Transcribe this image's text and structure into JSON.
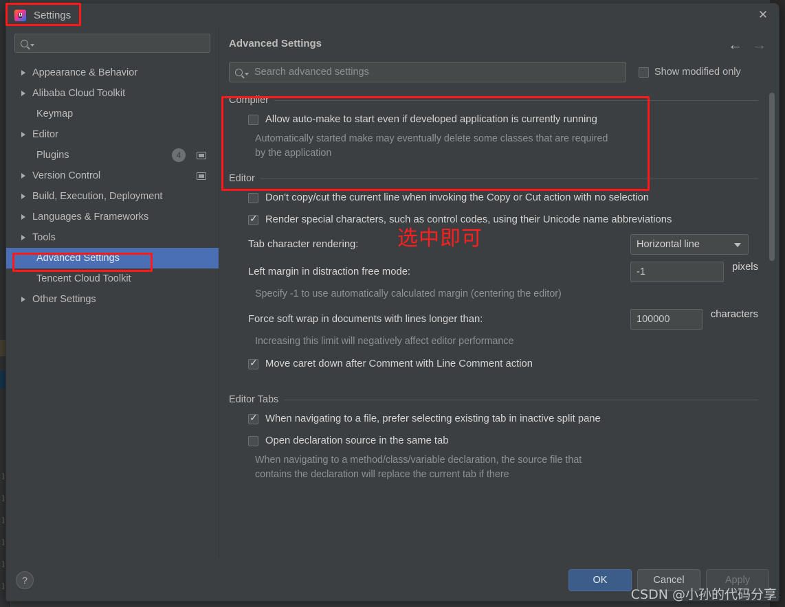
{
  "window": {
    "title": "Settings",
    "app_icon": "intellij-idea-icon",
    "close_label": "✕"
  },
  "sidebar": {
    "search_placeholder": "",
    "items": [
      {
        "label": "Appearance & Behavior",
        "expandable": true,
        "indent": false,
        "selected": false
      },
      {
        "label": "Alibaba Cloud Toolkit",
        "expandable": true,
        "indent": false,
        "selected": false
      },
      {
        "label": "Keymap",
        "expandable": false,
        "indent": true,
        "selected": false
      },
      {
        "label": "Editor",
        "expandable": true,
        "indent": false,
        "selected": false
      },
      {
        "label": "Plugins",
        "expandable": false,
        "indent": true,
        "selected": false,
        "badge": "4",
        "has_rect_icon": true
      },
      {
        "label": "Version Control",
        "expandable": true,
        "indent": false,
        "selected": false,
        "has_rect_icon": true
      },
      {
        "label": "Build, Execution, Deployment",
        "expandable": true,
        "indent": false,
        "selected": false
      },
      {
        "label": "Languages & Frameworks",
        "expandable": true,
        "indent": false,
        "selected": false
      },
      {
        "label": "Tools",
        "expandable": true,
        "indent": false,
        "selected": false
      },
      {
        "label": "Advanced Settings",
        "expandable": false,
        "indent": true,
        "selected": true
      },
      {
        "label": "Tencent Cloud Toolkit",
        "expandable": false,
        "indent": true,
        "selected": false
      },
      {
        "label": "Other Settings",
        "expandable": true,
        "indent": false,
        "selected": false
      }
    ]
  },
  "header": {
    "title": "Advanced Settings",
    "back_arrow": "←",
    "forward_arrow": "→"
  },
  "search": {
    "placeholder": "Search advanced settings",
    "show_modified_label": "Show modified only",
    "show_modified_checked": false
  },
  "sections": {
    "compiler": {
      "title": "Compiler",
      "option_label": "Allow auto-make to start even if developed application is currently running",
      "option_checked": false,
      "description": "Automatically started make may eventually delete some classes that are required by the application"
    },
    "editor": {
      "title": "Editor",
      "opt1_label": "Don't copy/cut the current line when invoking the Copy or Cut action with no selection",
      "opt1_checked": false,
      "opt2_label": "Render special characters, such as control codes, using their Unicode name abbreviations",
      "opt2_checked": true,
      "tab_render_label": "Tab character rendering:",
      "tab_render_value": "Horizontal line",
      "left_margin_label": "Left margin in distraction free mode:",
      "left_margin_value": "-1",
      "left_margin_unit": "pixels",
      "left_margin_desc": "Specify -1 to use automatically calculated margin (centering the editor)",
      "soft_wrap_label": "Force soft wrap in documents with lines longer than:",
      "soft_wrap_value": "100000",
      "soft_wrap_unit": "characters",
      "soft_wrap_desc": "Increasing this limit will negatively affect editor performance",
      "opt3_label": "Move caret down after Comment with Line Comment action",
      "opt3_checked": true
    },
    "editor_tabs": {
      "title": "Editor Tabs",
      "opt1_label": "When navigating to a file, prefer selecting existing tab in inactive split pane",
      "opt1_checked": true,
      "opt2_label": "Open declaration source in the same tab",
      "opt2_checked": false,
      "opt2_desc": "When navigating to a method/class/variable declaration, the source file that contains the declaration will replace the current tab if there"
    }
  },
  "footer": {
    "help_label": "?",
    "ok_label": "OK",
    "cancel_label": "Cancel",
    "apply_label": "Apply"
  },
  "annotations": {
    "note_text": "选中即可",
    "watermark": "CSDN @小孙的代码分享",
    "highlight_color": "#ff1a1a"
  }
}
